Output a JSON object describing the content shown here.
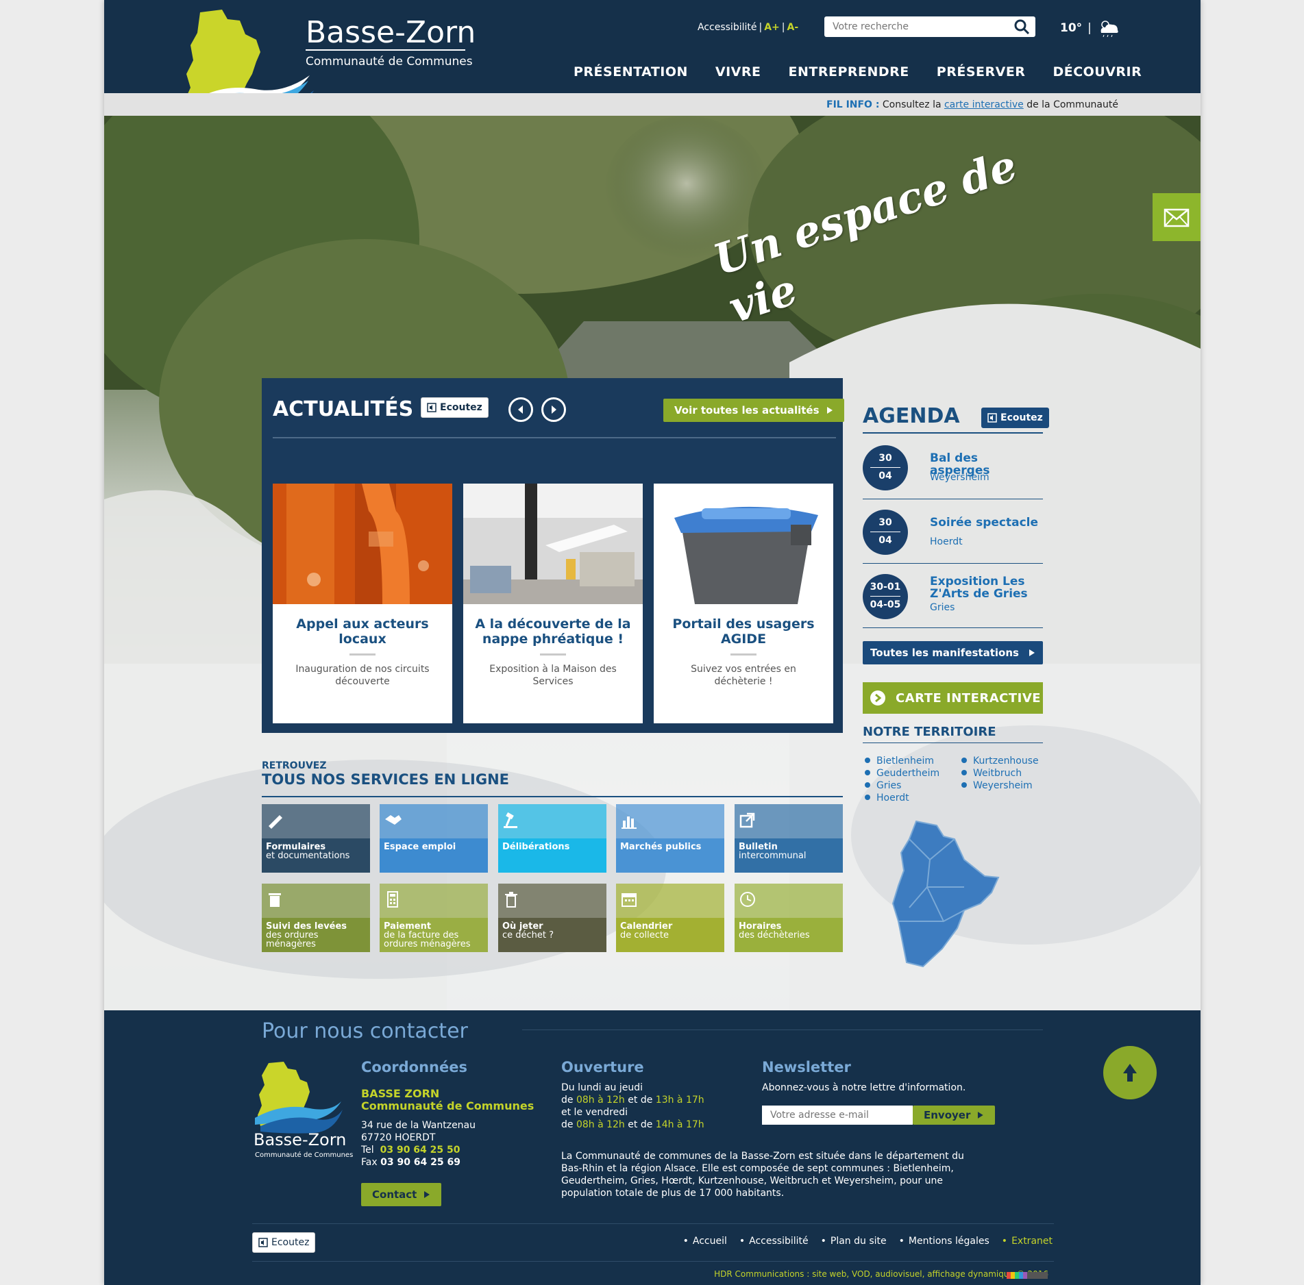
{
  "header": {
    "logo_title": "Basse-Zorn",
    "logo_subtitle": "Communauté de Communes",
    "accessibility_label": "Accessibilité",
    "font_increase": "A+",
    "font_decrease": "A-",
    "search_placeholder": "Votre recherche",
    "weather_temp": "10°",
    "nav": [
      "PRÉSENTATION",
      "VIVRE",
      "ENTREPRENDRE",
      "PRÉSERVER",
      "DÉCOUVRIR"
    ]
  },
  "infobar": {
    "label": "FIL INFO :",
    "text_before": "Consultez la",
    "link": "carte interactive",
    "text_after": "de la Communauté"
  },
  "hero": {
    "slogan": "Un espace de vie"
  },
  "news": {
    "title": "ACTUALITÉS",
    "listen": "Ecoutez",
    "all_label": "Voir toutes les actualités",
    "cards": [
      {
        "title": "Appel aux acteurs locaux",
        "desc": "Inauguration de nos circuits découverte"
      },
      {
        "title": "A la découverte de la nappe phréatique !",
        "desc": "Exposition à la Maison des Services"
      },
      {
        "title": "Portail des usagers AGIDE",
        "desc": "Suivez vos entrées en déchèterie !"
      }
    ]
  },
  "services": {
    "pre": "RETROUVEZ",
    "title": "TOUS NOS SERVICES EN LIGNE",
    "tiles": [
      {
        "bold": "Formulaires",
        "sub": "et documentations",
        "icon": "pen-icon",
        "color": "#2b4a64"
      },
      {
        "bold": "Espace emploi",
        "sub": "",
        "icon": "handshake-icon",
        "color": "#3d8bd0"
      },
      {
        "bold": "Délibérations",
        "sub": "",
        "icon": "gavel-icon",
        "color": "#1ab8e8"
      },
      {
        "bold": "Marchés publics",
        "sub": "",
        "icon": "chart-icon",
        "color": "#4a93d4"
      },
      {
        "bold": "Bulletin",
        "sub": "intercommunal",
        "icon": "external-link-icon",
        "color": "#3270a6"
      },
      {
        "bold": "Suivi des levées",
        "sub": "des ordures ménagères",
        "icon": "bin-icon",
        "color": "#7e9338"
      },
      {
        "bold": "Paiement",
        "sub": "de la facture des ordures ménagères",
        "icon": "calculator-icon",
        "color": "#9aae44"
      },
      {
        "bold": "Où jeter",
        "sub": "ce déchet ?",
        "icon": "trash-icon",
        "color": "#5b5c42"
      },
      {
        "bold": "Calendrier",
        "sub": "de collecte",
        "icon": "calendar-icon",
        "color": "#a3b032"
      },
      {
        "bold": "Horaires",
        "sub": "des déchèteries",
        "icon": "clock-icon",
        "color": "#9ab03c"
      }
    ]
  },
  "agenda": {
    "title": "AGENDA",
    "listen": "Ecoutez",
    "events": [
      {
        "d1": "30",
        "d2": "04",
        "title": "Bal des asperges",
        "place": "Weyersheim"
      },
      {
        "d1": "30",
        "d2": "04",
        "title": "Soirée spectacle",
        "place": "Hoerdt"
      },
      {
        "d1": "30-01",
        "d2": "04-05",
        "title": "Exposition Les Z'Arts de Gries",
        "place": "Gries"
      }
    ],
    "all_label": "Toutes les manifestations",
    "map_label": "CARTE INTERACTIVE"
  },
  "territory": {
    "title": "NOTRE TERRITOIRE",
    "col1": [
      "Bietlenheim",
      "Geudertheim",
      "Gries",
      "Hoerdt"
    ],
    "col2": [
      "Kurtzenhouse",
      "Weitbruch",
      "Weyersheim"
    ]
  },
  "footer": {
    "title": "Pour nous contacter",
    "logo_title": "Basse-Zorn",
    "logo_subtitle": "Communauté de Communes",
    "coords_title": "Coordonnées",
    "org1": "BASSE ZORN",
    "org2": "Communauté de Communes",
    "addr1": "34 rue de la Wantzenau",
    "addr2": "67720 HOERDT",
    "tel_label": "Tel",
    "tel": "03 90 64 25 50",
    "fax_label": "Fax",
    "fax": "03 90 64 25 69",
    "contact_btn": "Contact",
    "hours_title": "Ouverture",
    "h1": "Du lundi au jeudi",
    "h2a": "de",
    "h2b": "08h à 12h",
    "h2c": "et de",
    "h2d": "13h à 17h",
    "h3": "et le vendredi",
    "h4a": "de",
    "h4b": "08h à 12h",
    "h4c": "et de",
    "h4d": "14h à 17h",
    "nl_title": "Newsletter",
    "nl_text": "Abonnez-vous à notre lettre d'information.",
    "nl_placeholder": "Votre adresse e-mail",
    "nl_btn": "Envoyer",
    "about": "La Communauté de communes de la Basse-Zorn est située dans le département du Bas-Rhin et la région Alsace. Elle est composée de sept communes : Bietlenheim, Geudertheim, Gries, Hœrdt, Kurtzenhouse, Weitbruch et Weyersheim, pour une population totale de plus de 17 000 habitants.",
    "listen": "Ecoutez",
    "links": [
      "Accueil",
      "Accessibilité",
      "Plan du site",
      "Mentions légales",
      "Extranet"
    ],
    "credit": "HDR Communications : site web, VOD, audiovisuel, affichage dynamique © 2016"
  },
  "colors": {
    "navy": "#15304a",
    "green": "#8aa92a",
    "lime": "#c4d32a",
    "blue": "#1a5080"
  }
}
